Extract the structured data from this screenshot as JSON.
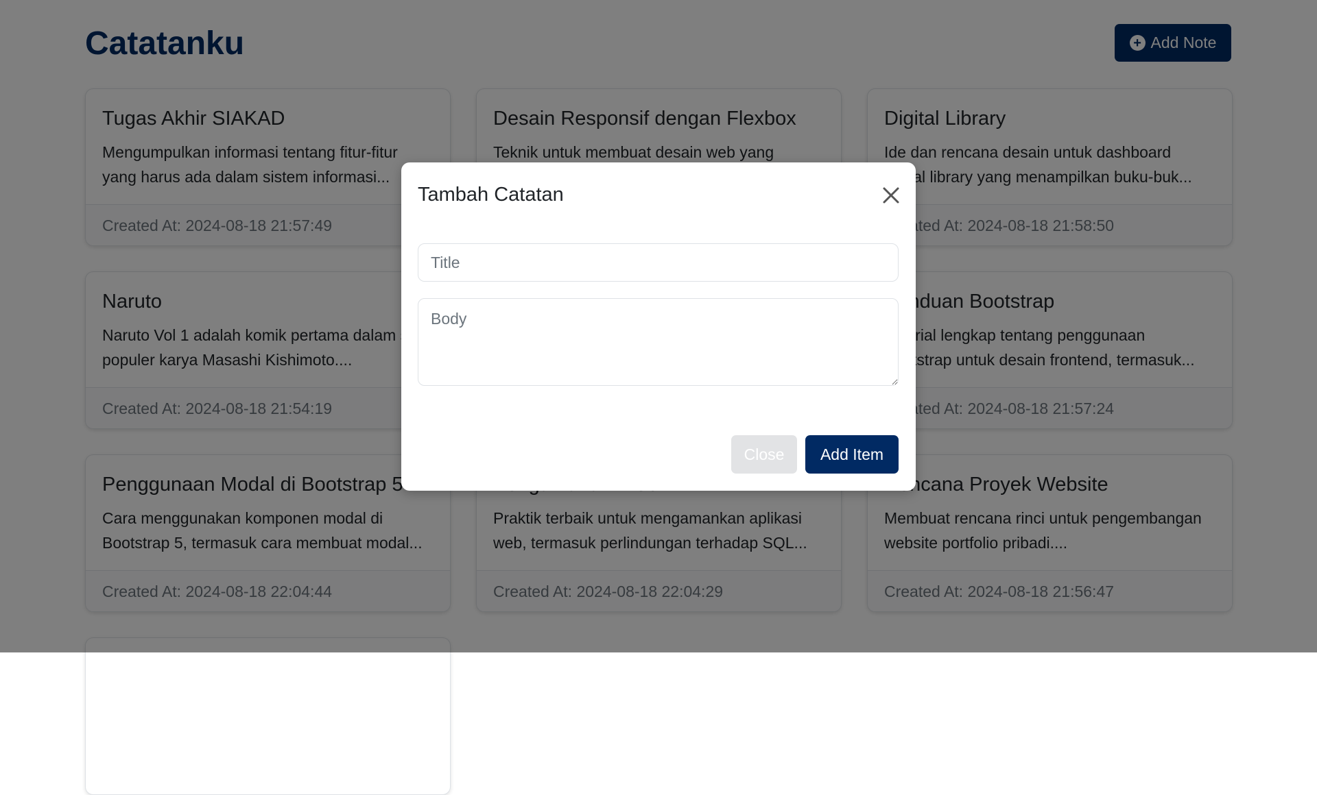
{
  "app": {
    "title": "Catatanku",
    "add_note_label": "Add Note",
    "add_note_icon": "plus-circle-icon",
    "brand_color": "#012a63"
  },
  "notes": [
    {
      "title": "Tugas Akhir SIAKAD",
      "body": "Mengumpulkan informasi tentang fitur-fitur yang harus ada dalam sistem informasi...",
      "created": "Created At: 2024-08-18 21:57:49"
    },
    {
      "title": "Desain Responsif dengan Flexbox",
      "body": "Teknik untuk membuat desain web yang",
      "created": ""
    },
    {
      "title": "Digital Library",
      "body": "Ide dan rencana desain untuk dashboard digital library yang menampilkan buku-buk...",
      "created": "Created At: 2024-08-18 21:58:50"
    },
    {
      "title": "Naruto",
      "body": "Naruto Vol 1 adalah komik pertama dalam seri populer karya Masashi Kishimoto....",
      "created": "Created At: 2024-08-18 21:54:19"
    },
    {
      "title": "",
      "body": "",
      "created": ""
    },
    {
      "title": "Panduan Bootstrap",
      "body": "Tutorial lengkap tentang penggunaan Bootstrap untuk desain frontend, termasuk...",
      "created": "Created At: 2024-08-18 21:57:24"
    },
    {
      "title": "Penggunaan Modal di Bootstrap 5",
      "body": "Cara menggunakan komponen modal di Bootstrap 5, termasuk cara membuat modal...",
      "created": "Created At: 2024-08-18 22:04:44"
    },
    {
      "title": "Pengamanan Web",
      "body": "Praktik terbaik untuk mengamankan aplikasi web, termasuk perlindungan terhadap SQL...",
      "created": "Created At: 2024-08-18 22:04:29"
    },
    {
      "title": "Rencana Proyek Website",
      "body": "Membuat rencana rinci untuk pengembangan website portfolio pribadi....",
      "created": "Created At: 2024-08-18 21:56:47"
    },
    {
      "title": "",
      "body": "",
      "created": ""
    }
  ],
  "modal": {
    "title": "Tambah Catatan",
    "title_placeholder": "Title",
    "title_value": "",
    "body_placeholder": "Body",
    "body_value": "",
    "close_label": "Close",
    "add_label": "Add Item",
    "close_icon": "close-icon"
  }
}
